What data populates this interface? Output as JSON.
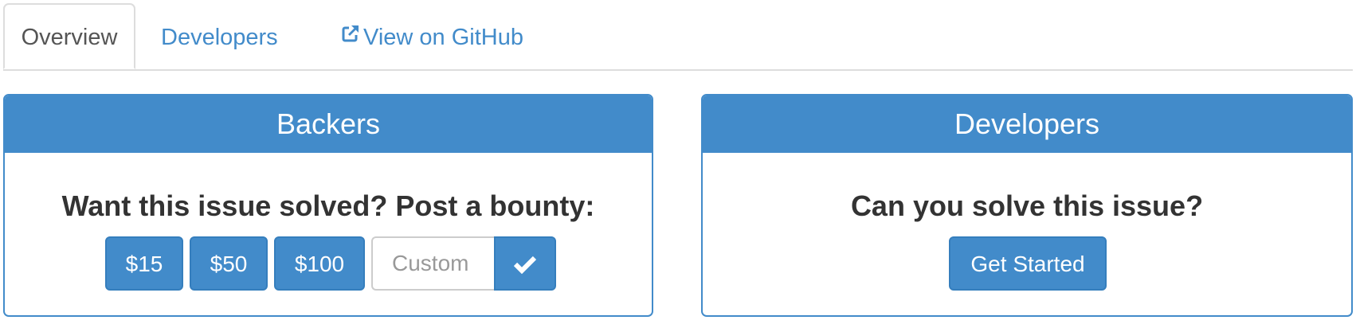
{
  "tabs": [
    {
      "label": "Overview",
      "active": true
    },
    {
      "label": "Developers",
      "active": false
    },
    {
      "label": "View on GitHub",
      "active": false,
      "icon": "external-link-icon"
    }
  ],
  "backers": {
    "heading": "Backers",
    "question": "Want this issue solved? Post a bounty:",
    "amounts": [
      "$15",
      "$50",
      "$100"
    ],
    "custom_placeholder": "Custom",
    "submit_icon": "checkmark-icon"
  },
  "developers": {
    "heading": "Developers",
    "question": "Can you solve this issue?",
    "cta_label": "Get Started"
  },
  "colors": {
    "primary": "#428bca",
    "primary_border": "#357ebd",
    "text": "#333333",
    "border": "#dddddd"
  }
}
